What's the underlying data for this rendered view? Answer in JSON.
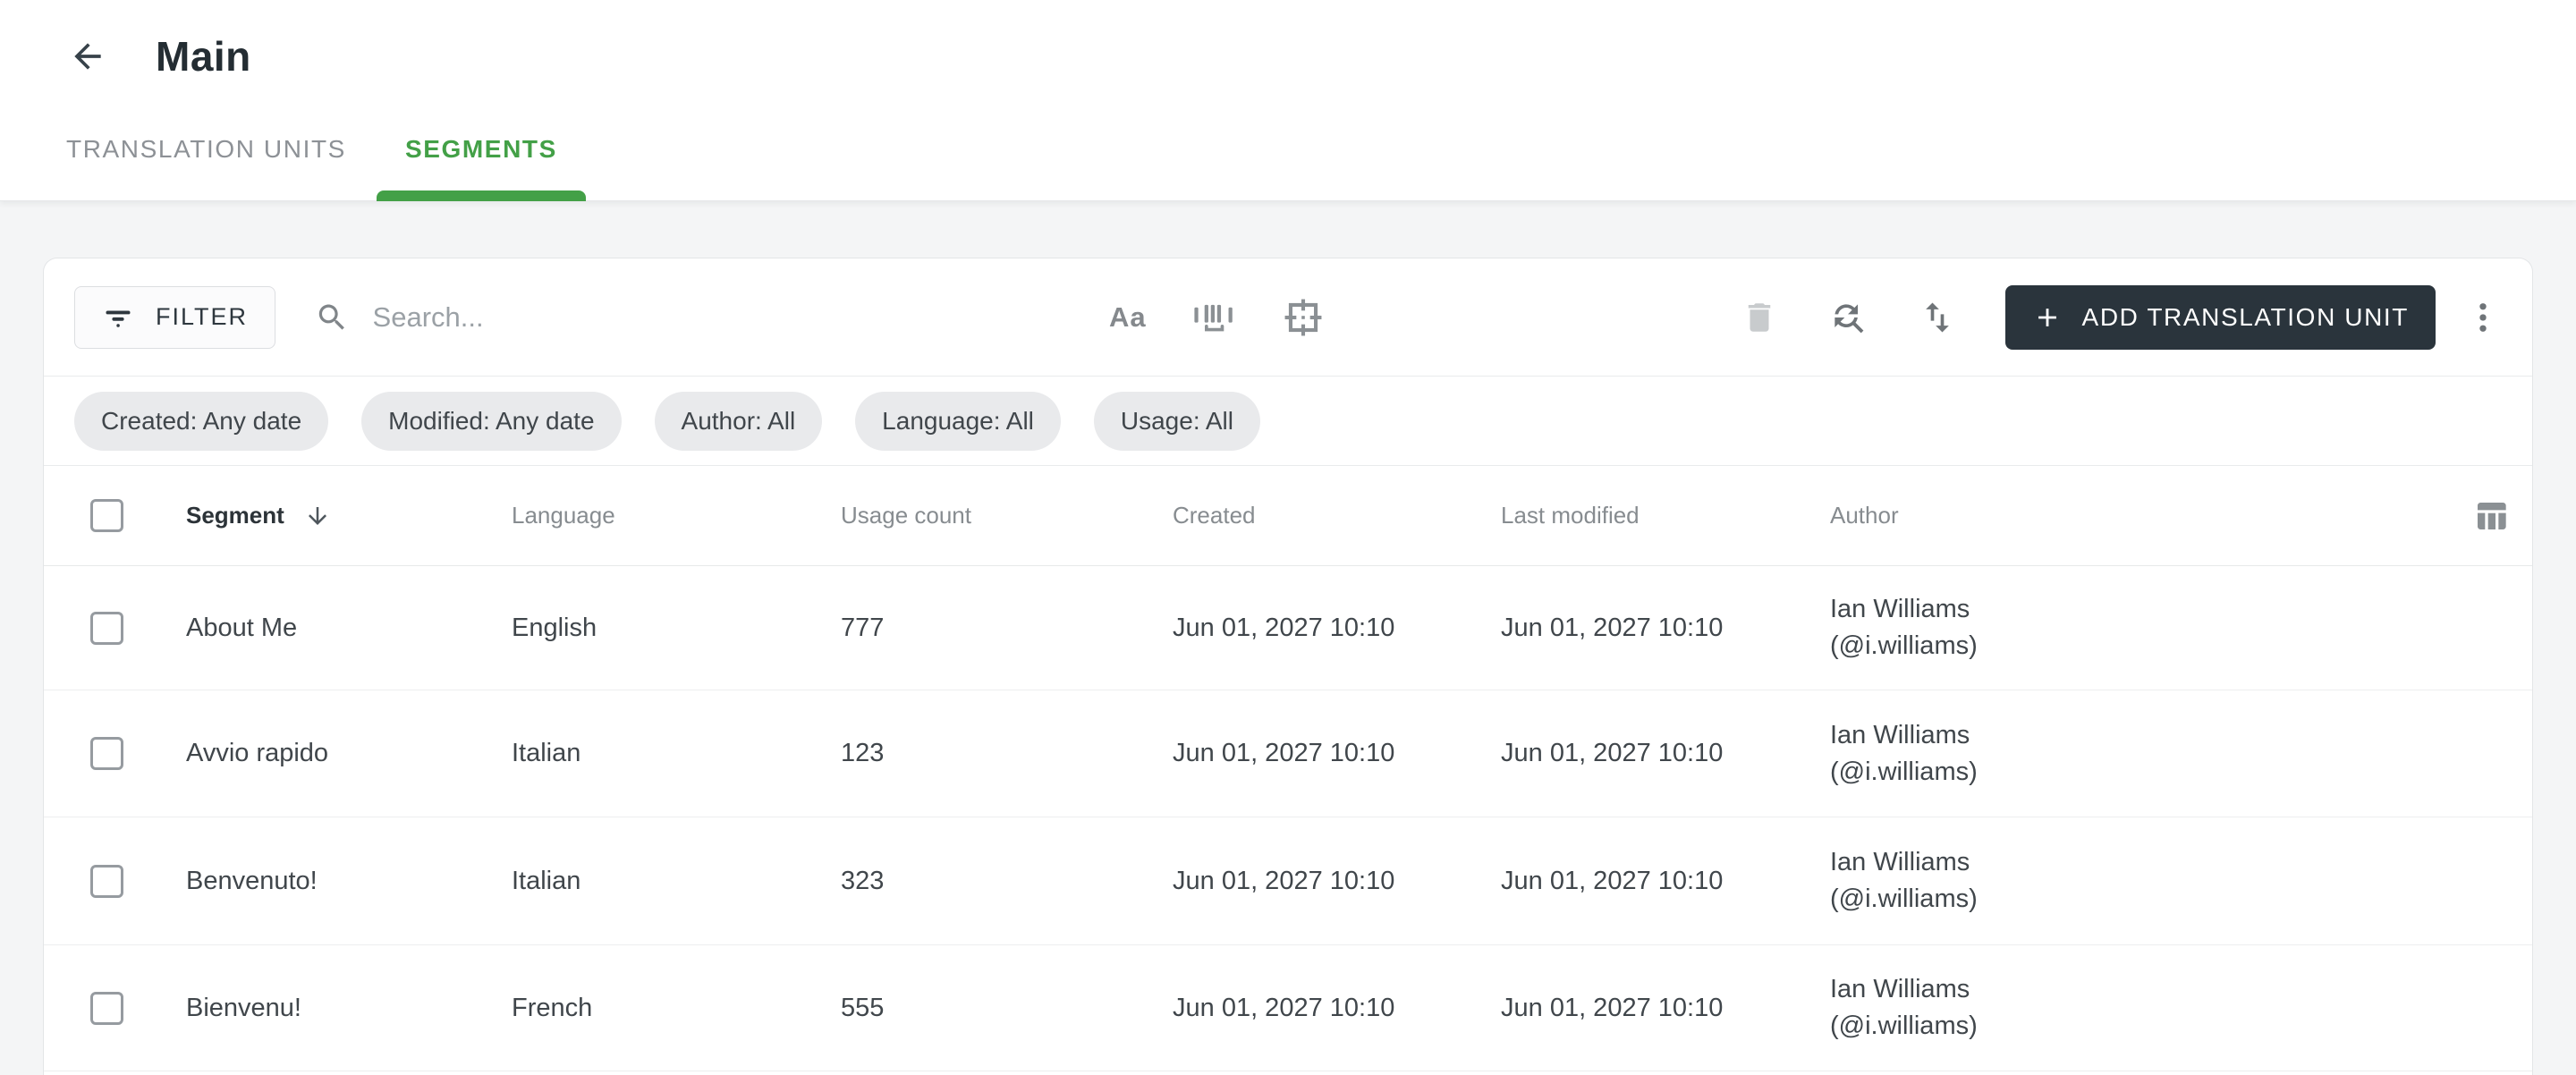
{
  "page": {
    "title": "Main"
  },
  "tabs": [
    {
      "label": "TRANSLATION UNITS",
      "active": false
    },
    {
      "label": "SEGMENTS",
      "active": true
    }
  ],
  "toolbar": {
    "filter_label": "FILTER",
    "search_placeholder": "Search...",
    "match_case_label": "Aa",
    "add_button_label": "ADD TRANSLATION UNIT"
  },
  "filter_chips": [
    {
      "label": "Created: Any date"
    },
    {
      "label": "Modified: Any date"
    },
    {
      "label": "Author: All"
    },
    {
      "label": "Language: All"
    },
    {
      "label": "Usage: All"
    }
  ],
  "table": {
    "columns": [
      "Segment",
      "Language",
      "Usage count",
      "Created",
      "Last modified",
      "Author"
    ],
    "sorted_column": "Segment",
    "sort_direction": "descending",
    "rows": [
      {
        "segment": "About Me",
        "language": "English",
        "usage_count": "777",
        "created": "Jun 01, 2027 10:10",
        "last_modified": "Jun 01, 2027 10:10",
        "author_name": "Ian Williams",
        "author_handle": "(@i.williams)"
      },
      {
        "segment": "Avvio rapido",
        "language": "Italian",
        "usage_count": "123",
        "created": "Jun 01, 2027 10:10",
        "last_modified": "Jun 01, 2027 10:10",
        "author_name": "Ian Williams",
        "author_handle": "(@i.williams)"
      },
      {
        "segment": "Benvenuto!",
        "language": "Italian",
        "usage_count": "323",
        "created": "Jun 01, 2027 10:10",
        "last_modified": "Jun 01, 2027 10:10",
        "author_name": "Ian Williams",
        "author_handle": "(@i.williams)"
      },
      {
        "segment": "Bienvenu!",
        "language": "French",
        "usage_count": "555",
        "created": "Jun 01, 2027 10:10",
        "last_modified": "Jun 01, 2027 10:10",
        "author_name": "Ian Williams",
        "author_handle": "(@i.williams)"
      }
    ]
  },
  "icons": {
    "back": "arrow-left",
    "filter": "filter-lines",
    "search": "magnifier",
    "match_case": "Aa",
    "whole_word": "barcode",
    "regex_frame": "focus-frame",
    "delete": "trash",
    "find_replace": "circular-arrows-magnifier",
    "sort": "swap-vertical",
    "add": "plus",
    "menu": "kebab-vertical-dots",
    "columns": "table-columns",
    "header_sort": "arrow-down"
  },
  "colors": {
    "accent_green": "#43a047",
    "button_dark": "#2a343c",
    "chip_bg": "#e9eaec",
    "page_bg": "#f4f5f6",
    "disabled_icon": "#c8cbcd",
    "icon_gray": "#6f7478"
  }
}
